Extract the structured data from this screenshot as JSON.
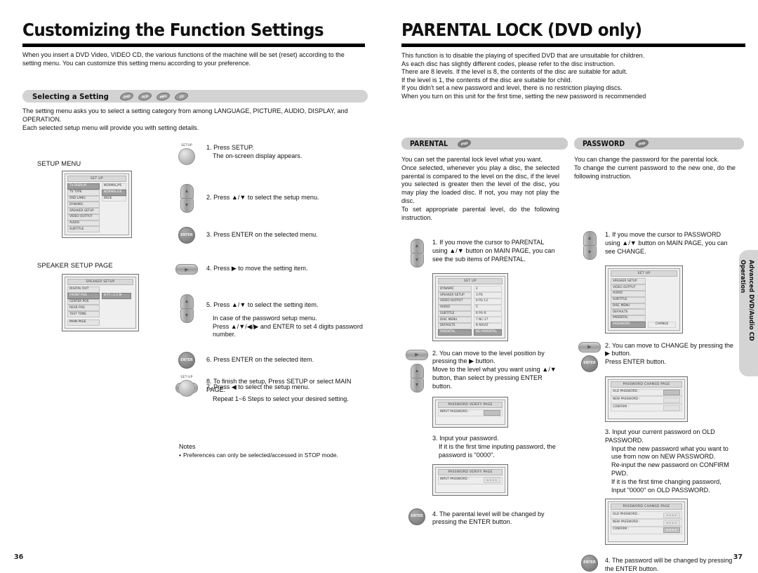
{
  "left_page": {
    "number": "36",
    "title": "Customizing the Function Settings",
    "intro": "When you insert a DVD Video, VIDEO CD, the various functions of the machine will be set (reset) according to the setting menu. You can customize this setting menu according to your preference.",
    "section": {
      "label": "Selecting a Setting",
      "media_icons": [
        "DVD",
        "VCD",
        "MP3",
        "CD"
      ]
    },
    "body": [
      "The setting menu asks you to select a setting category from among LANGUAGE, PICTURE, AUDIO, DISPLAY, and OPERATION.",
      "Each selected setup menu will provide you with setting details."
    ],
    "setup_menu_caption": "SETUP MENU",
    "setup_menu": {
      "title": "SET UP",
      "items": [
        "TV DISPLAY",
        "TV TYPE",
        "OSD LANG",
        "DYNAMIC",
        "SPEAKER SETUP",
        "VIDEO OUTPUT",
        "AUDIO",
        "SUBTITLE"
      ],
      "selected_item": "TV DISPLAY",
      "values": [
        "NORMAL/PS",
        "NORMAL/LB",
        "WIDE"
      ],
      "selected_value": "NORMAL/LB"
    },
    "speaker_caption": "SPEAKER SETUP PAGE",
    "speaker_menu": {
      "title": "SPEAKER SETUP",
      "items": [
        "DIGITAL OUT",
        "FRONT POS",
        "CENTER POS",
        "REAR POS",
        "TEST TONE"
      ],
      "selected_item": "FRONT POS",
      "selected_value": "8 FT / 2.5 M",
      "footer_item": "MAIN PAGE"
    },
    "steps": [
      {
        "num": "1.",
        "button": "setup-round",
        "button_label": "SETUP",
        "lines": [
          "1. Press SETUP.",
          "The on-screen display appears."
        ]
      },
      {
        "num": "2.",
        "button": "up-down",
        "lines": [
          "2. Press ▲/▼ to select the setup menu."
        ]
      },
      {
        "num": "3.",
        "button": "enter",
        "button_label": "ENTER",
        "lines": [
          "3. Press ENTER on the selected menu."
        ]
      },
      {
        "num": "4.",
        "button": "right",
        "lines": [
          "4. Press ▶ to move the setting item."
        ]
      },
      {
        "num": "5.",
        "button": "up-down",
        "lines": [
          "5. Press ▲/▼ to select the setting item.",
          "In case of the password setup menu.",
          "Press ▲/▼/◀/▶ and ENTER to set 4 digits password number."
        ]
      },
      {
        "num": "6.",
        "button": "enter",
        "button_label": "ENTER",
        "lines": [
          "6. Press ENTER on the selected item."
        ]
      },
      {
        "num": "7.",
        "button": "left",
        "lines": [
          "7. Press ◀ to select the setup menu."
        ]
      },
      {
        "num": "8.",
        "button": "setup-round",
        "button_label": "SET-UP",
        "lines": [
          "8. To finish the setup, Press SETUP or select MAIN PAGE.",
          "Repeat 1~6 Steps to select your desired setting."
        ]
      }
    ],
    "notes_title": "Notes",
    "notes_items": [
      "Preferences can only be selected/accessed in STOP mode."
    ]
  },
  "right_page": {
    "number": "37",
    "title": "PARENTAL LOCK (DVD only)",
    "intro_lines": [
      "This function is to disable the playing of specified DVD that are unsuitable for children.",
      "As each disc has slightly different codes, please refer to the disc instruction.",
      "There are 8 levels. If the level is 8, the contents of the disc are suitable for adult.",
      "If the level is 1, the contents of the disc are suitable for child.",
      "If you didn't set a new password and level, there is no restriction playing discs.",
      "When you turn on this unit for the first time, setting the new password is recommended"
    ],
    "side_tab": "Advanced DVD/Audio CD\nOperation",
    "parental": {
      "section_label": "PARENTAL",
      "media_icon": "DVD",
      "body_lines": [
        "You can set the parental lock level what you want.",
        "Once selected, whenever you play a disc, the selected parental is compared to the level on the disc, if the level you selected is greater then the level of the disc, you may play the loaded disc. If not, you may not play the disc.",
        "To set appropriate parental level, do the following instruction."
      ],
      "step1": {
        "button": "up-down",
        "lines": [
          "1. If you move the cursor to PARENTAL using ▲/▼ button on MAIN PAGE, you can see the sub items of PARENTAL."
        ]
      },
      "menu": {
        "title": "SET UP",
        "items": [
          "DYNAMIC",
          "SPEAKER SETUP",
          "VIDEO OUTPUT",
          "AUDIO",
          "SUBTITLE",
          "DISC MENU",
          "DEFAULTS",
          "PARENTAL"
        ],
        "selected_item": "PARENTAL",
        "values": [
          "2",
          "3 PG",
          "4 PG 13",
          "5",
          "6 PG-R",
          "7 NC-17",
          "8 ADULT",
          "NO PARENTAL"
        ],
        "selected_value": "NO PARENTAL"
      },
      "step2": {
        "buttons": [
          "right",
          "up-down"
        ],
        "lines": [
          "2. You can move to the level position by pressing the ▶ button.",
          "Move to the level what you want using ▲/▼ button, than select by pressing ENTER button."
        ]
      },
      "verify_page_1": {
        "title": "PASSWORD VERIFY PAGE",
        "field_label": "INPUT PASSWORD :",
        "field_value": ""
      },
      "step3": {
        "lines": [
          "3. Input your password.",
          "If it is the first time inputing password, the password is \"0000\"."
        ]
      },
      "verify_page_2": {
        "title": "PASSWORD VERIFY PAGE",
        "field_label": "INPUT PASSWORD :",
        "field_value": "∗∗∗∗"
      },
      "step4": {
        "button": "enter",
        "button_label": "ENTER",
        "lines": [
          "4. The parental level will be changed by pressing the ENTER button."
        ]
      }
    },
    "password": {
      "section_label": "PASSWORD",
      "media_icon": "DVD",
      "body_lines": [
        "You can change the password for the parental lock.",
        "To change the current password to the new one, do the following instruction."
      ],
      "step1": {
        "button": "up-down",
        "lines": [
          "1. If you move the cursor to PASSWORD using ▲/▼ button on MAIN PAGE, you can see CHANGE."
        ]
      },
      "menu": {
        "title": "SET UP",
        "items": [
          "SPEAKER SETUP",
          "VIDEO OUTPUT",
          "AUDIO",
          "SUBTITLE",
          "DISC MENU",
          "DEFAULTS",
          "PARENTAL",
          "PASSWORD"
        ],
        "selected_item": "PASSWORD",
        "values": [
          "CHANGE"
        ],
        "selected_value": "CHANGE"
      },
      "step2": {
        "buttons": [
          "right",
          "enter"
        ],
        "lines": [
          "2. You can move to CHANGE by pressing the ▶ button.",
          "Press ENTER button."
        ]
      },
      "change_page_1": {
        "title": "PASSWORD CHANGE PAGE",
        "rows": [
          {
            "label": "OLD PASSWORD :",
            "value": ""
          },
          {
            "label": "NEW PASSWORD :",
            "value": ""
          },
          {
            "label": "CONFIRM :",
            "value": ""
          }
        ]
      },
      "step3": {
        "lines": [
          "3. Input your current password on OLD PASSWORD.",
          "Input the new password what you want to use from now on NEW PASSWORD.",
          "Re-input the new password on CONFIRM PWD.",
          "If it is the first time changing password, Input \"0000\" on OLD PASSWORD."
        ]
      },
      "change_page_2": {
        "title": "PASSWORD CHANGE PAGE",
        "rows": [
          {
            "label": "OLD PASSWORD :",
            "value": "∗∗∗∗"
          },
          {
            "label": "NEW PASSWORD :",
            "value": "∗∗∗∗"
          },
          {
            "label": "CONFIRM :",
            "value": "∗∗∗∗"
          }
        ]
      },
      "step4": {
        "button": "enter",
        "button_label": "ENTER",
        "lines": [
          "4. The password will be changed by pressing the ENTER button."
        ]
      }
    }
  },
  "colors": {
    "rule": "#000000",
    "section_bar": "#d3d3d3",
    "osd_selected": "#9d9d9d",
    "side_tab": "#d4d4d4"
  }
}
